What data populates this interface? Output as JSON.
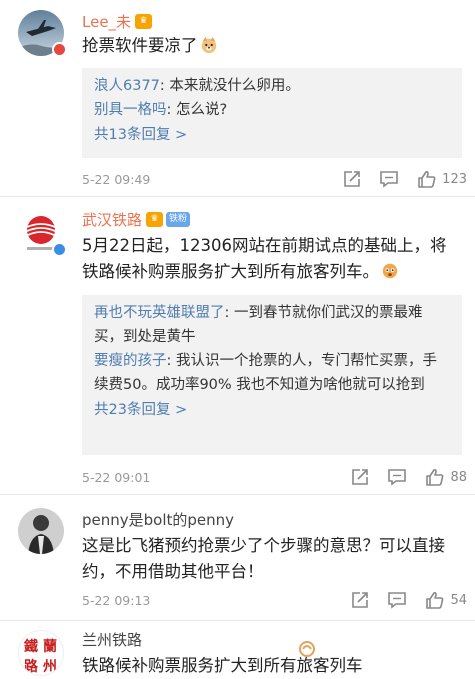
{
  "comments": [
    {
      "user": "Lee_未",
      "text": "抢票软件要凉了",
      "replies": [
        {
          "name": "浪人6377",
          "text": ": 本来就没什么卵用。"
        },
        {
          "name": "别具一格吗",
          "text": ": 怎么说?"
        }
      ],
      "more": "共13条回复 >",
      "time": "5-22 09:49",
      "likes": "123"
    },
    {
      "user": "武汉铁路",
      "tag": "铁粉",
      "text": "5月22日起，12306网站在前期试点的基础上，将铁路候补购票服务扩大到所有旅客列车。",
      "replies": [
        {
          "name": "再也不玩英雄联盟了",
          "text": ": 一到春节就你们武汉的票最难买，到处是黄牛"
        },
        {
          "name": "要瘦的孩子",
          "text": ": 我认识一个抢票的人，专门帮忙买票，手续费50。成功率90%   我也不知道为啥他就可以抢到"
        }
      ],
      "more": "共23条回复 >",
      "time": "5-22 09:01",
      "likes": "88"
    },
    {
      "user": "penny是bolt的penny",
      "text": "这是比飞猪预约抢票少了个步骤的意思？可以直接约，不用借助其他平台！",
      "time": "5-22 09:13",
      "likes": "54"
    },
    {
      "user": "兰州铁路",
      "avatar_text": "鐵 蘭 路 州",
      "text": "铁路候补购票服务扩大到所有旅客列车"
    }
  ],
  "colors": {
    "orange_name": "#eb7350",
    "link_blue": "#507daf",
    "reply_bg": "#f2f2f2",
    "meta_gray": "#999999"
  },
  "icons": [
    "share-icon",
    "comment-icon",
    "like-icon"
  ]
}
